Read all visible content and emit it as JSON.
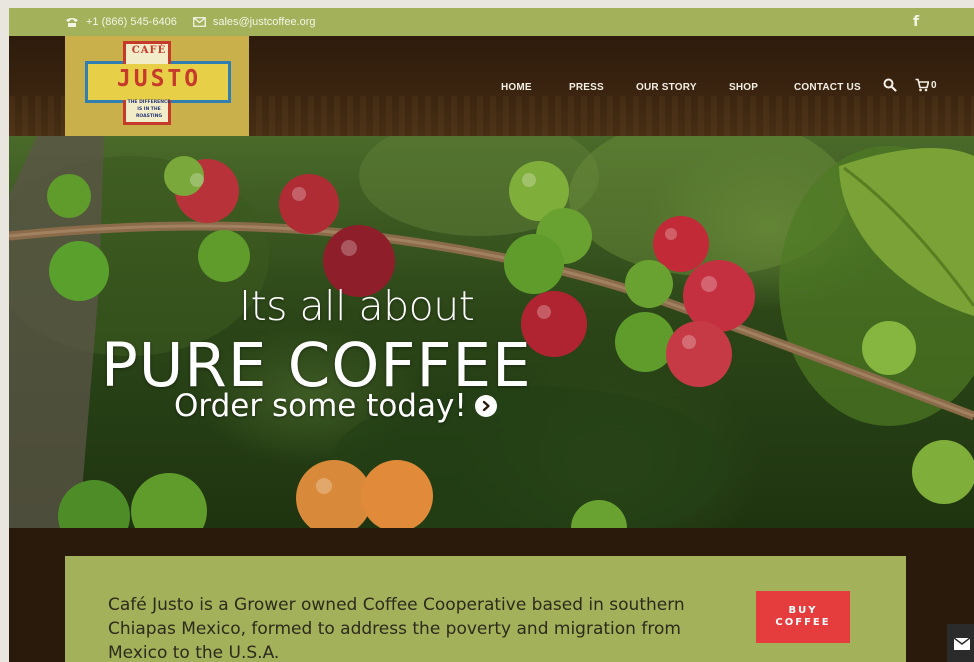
{
  "topbar": {
    "phone": "+1 (866) 545-6406",
    "email": "sales@justcoffee.org",
    "phone_icon": "phone-icon",
    "mail_icon": "mail-icon",
    "social_icon": "facebook-icon",
    "social_glyph": "f"
  },
  "logo": {
    "top": "CAFÉ",
    "name": "JUSTO",
    "tagline": "THE DIFFERENCE IS IN THE ROASTING"
  },
  "nav": {
    "items": [
      "HOME",
      "PRESS",
      "OUR STORY",
      "SHOP",
      "CONTACT US"
    ],
    "cart_count": "0"
  },
  "hero": {
    "line1": "Its all about",
    "line2": "PURE COFFEE",
    "cta": "Order some today!"
  },
  "info": {
    "text": "Café Justo is a Grower owned Coffee Cooperative based in southern Chiapas Mexico, formed to address the poverty and migration from Mexico to the U.S.A.",
    "button": "BUY COFFEE"
  },
  "colors": {
    "accent_green": "#a2b15a",
    "header_brown": "#2a1a0b",
    "button_red": "#e53c3e"
  }
}
